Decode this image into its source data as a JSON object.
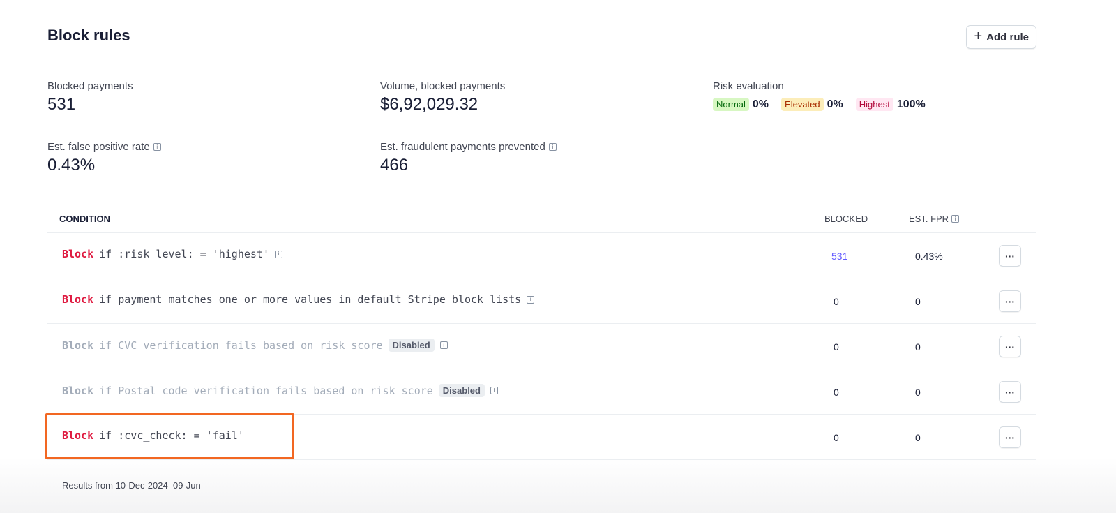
{
  "header": {
    "title": "Block rules",
    "add_rule_label": "Add rule",
    "add_icon": "plus-icon"
  },
  "metrics": {
    "blocked_payments": {
      "label": "Blocked payments",
      "value": "531"
    },
    "volume": {
      "label": "Volume, blocked payments",
      "value": "$6,92,029.32"
    },
    "risk": {
      "label": "Risk evaluation",
      "normal": {
        "badge": "Normal",
        "value": "0%"
      },
      "elevated": {
        "badge": "Elevated",
        "value": "0%"
      },
      "highest": {
        "badge": "Highest",
        "value": "100%"
      }
    },
    "false_positive": {
      "label": "Est. false positive rate",
      "value": "0.43%"
    },
    "fraud_prevented": {
      "label": "Est. fraudulent payments prevented",
      "value": "466"
    }
  },
  "table": {
    "headers": {
      "condition": "CONDITION",
      "blocked": "BLOCKED",
      "fpr": "EST. FPR"
    },
    "rows": [
      {
        "keyword": "Block",
        "text": "if :risk_level: = 'highest'",
        "disabled": false,
        "badge": "",
        "blocked": "531",
        "fpr": "0.43%"
      },
      {
        "keyword": "Block",
        "text": "if payment matches one or more values in default Stripe block lists",
        "disabled": false,
        "badge": "",
        "blocked": "0",
        "fpr": "0"
      },
      {
        "keyword": "Block",
        "text": "if CVC verification fails based on risk score",
        "disabled": true,
        "badge": "Disabled",
        "blocked": "0",
        "fpr": "0"
      },
      {
        "keyword": "Block",
        "text": "if Postal code verification fails based on risk score",
        "disabled": true,
        "badge": "Disabled",
        "blocked": "0",
        "fpr": "0"
      },
      {
        "keyword": "Block",
        "text": "if :cvc_check: = 'fail'",
        "disabled": false,
        "badge": "",
        "blocked": "0",
        "fpr": "0"
      }
    ],
    "more_label": "···"
  },
  "footer": {
    "text": "Results from 10-Dec-2024–09-Jun"
  },
  "colors": {
    "accent": "#635bff",
    "block_keyword": "#df1b41",
    "highlight": "#f26722"
  }
}
